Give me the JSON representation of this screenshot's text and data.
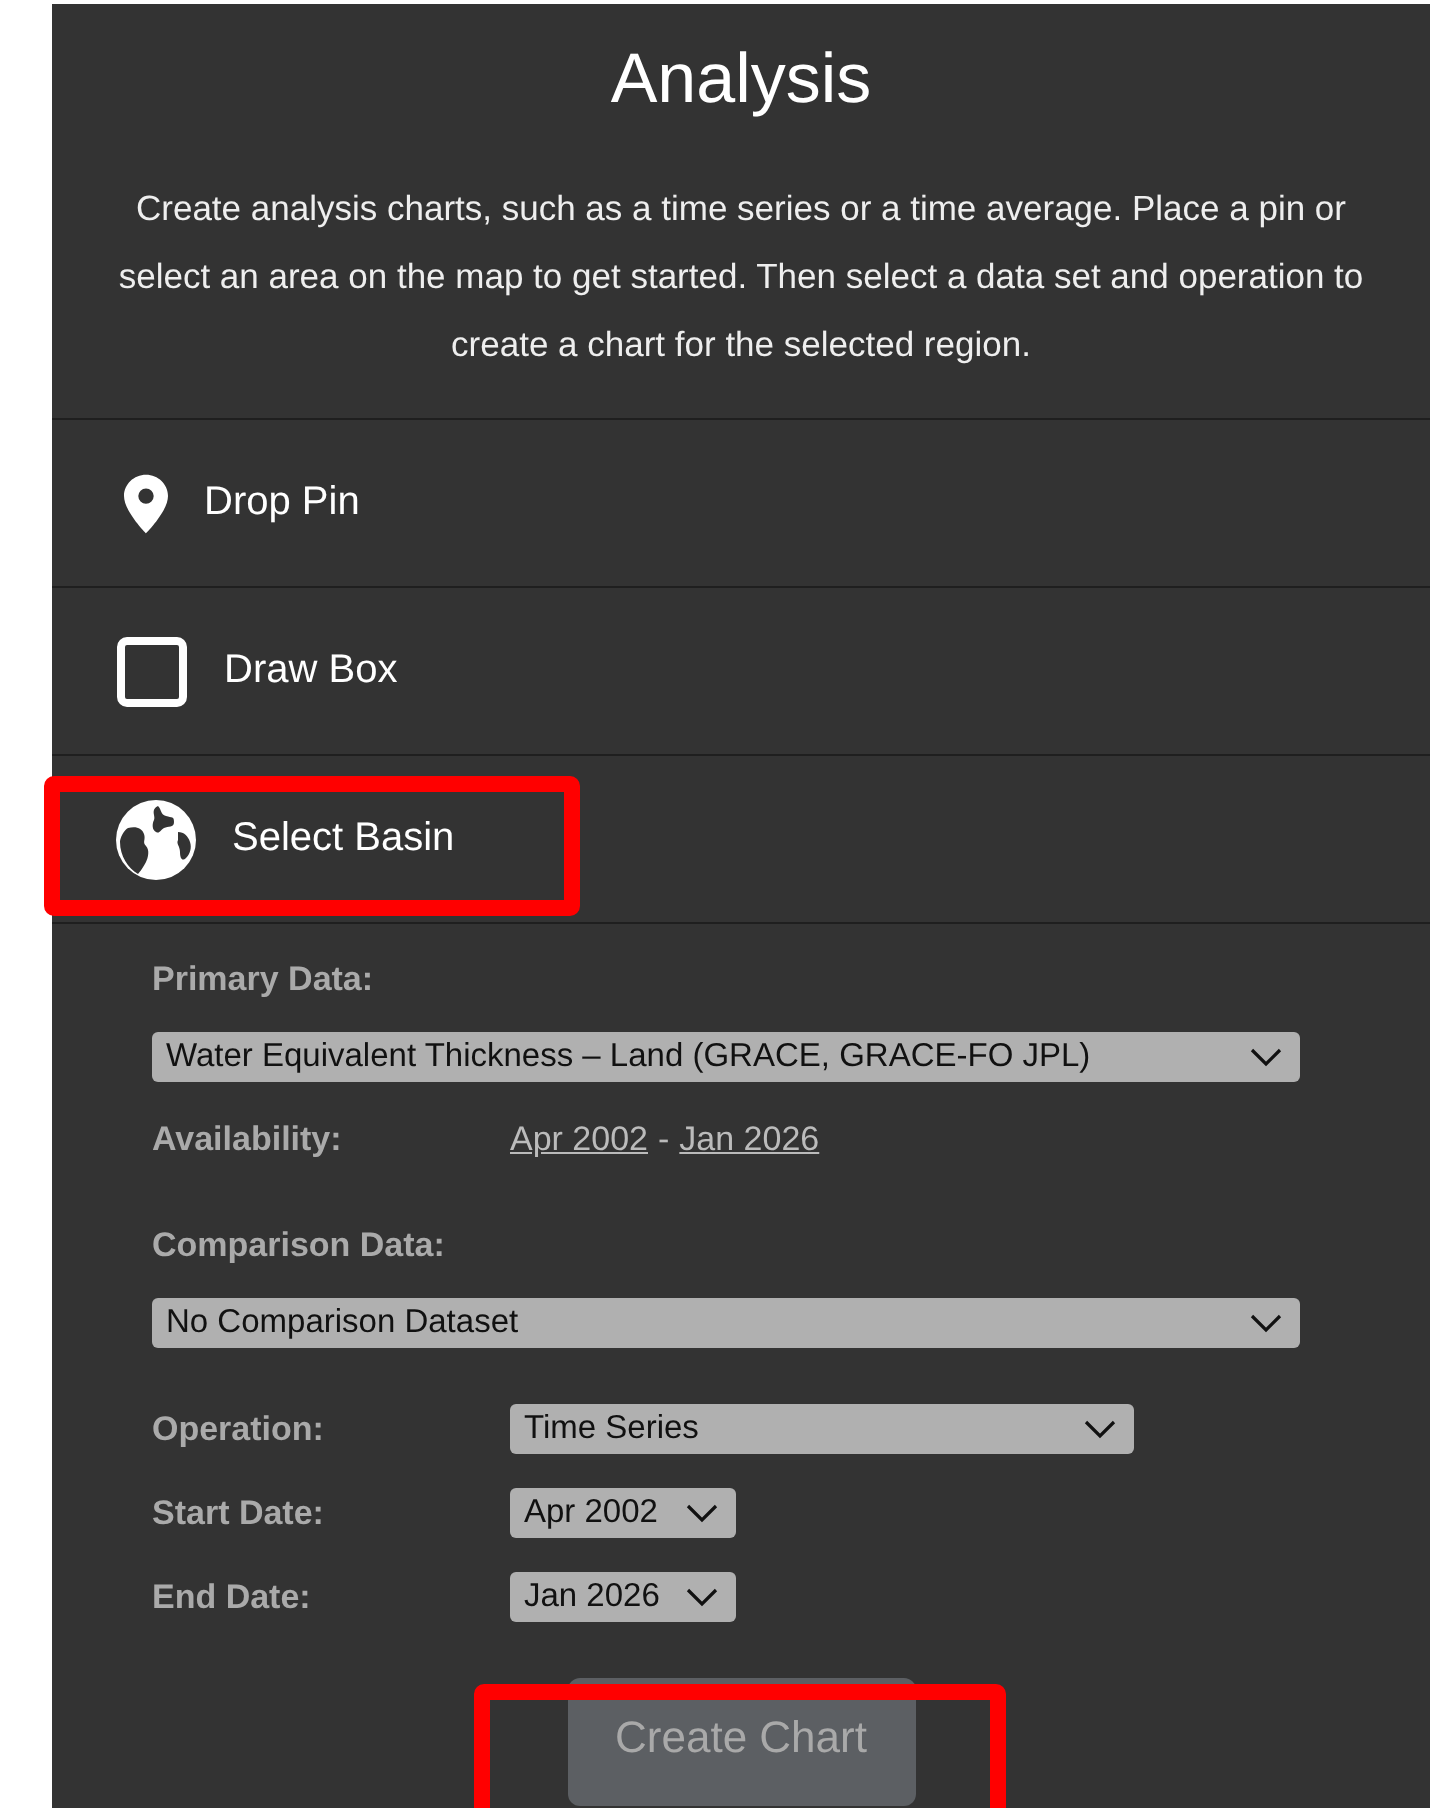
{
  "panel": {
    "title": "Analysis",
    "description": "Create analysis charts, such as a time series or a time average. Place a pin or select an area on the map to get started. Then select a data set and operation to create a chart for the selected region."
  },
  "tools": [
    {
      "kind": "pin",
      "label": "Drop Pin",
      "highlighted": false
    },
    {
      "kind": "box",
      "label": "Draw Box",
      "highlighted": false
    },
    {
      "kind": "globe",
      "label": "Select Basin",
      "highlighted": true
    }
  ],
  "form": {
    "primary_data": {
      "label": "Primary Data:",
      "value": "Water Equivalent Thickness – Land (GRACE, GRACE-FO JPL)"
    },
    "availability": {
      "label": "Availability:",
      "start": "Apr 2002",
      "separator": "-",
      "end": "Jan 2026"
    },
    "comparison_data": {
      "label": "Comparison Data:",
      "value": "No Comparison Dataset"
    },
    "fields": [
      {
        "kind": "operation",
        "label": "Operation:",
        "value": "Time Series"
      },
      {
        "kind": "date",
        "label": "Start Date:",
        "value": "Apr 2002"
      },
      {
        "kind": "date",
        "label": "End Date:",
        "value": "Jan 2026"
      }
    ]
  },
  "create_button": {
    "label": "Create Chart",
    "disabled": true,
    "highlighted": true
  }
}
